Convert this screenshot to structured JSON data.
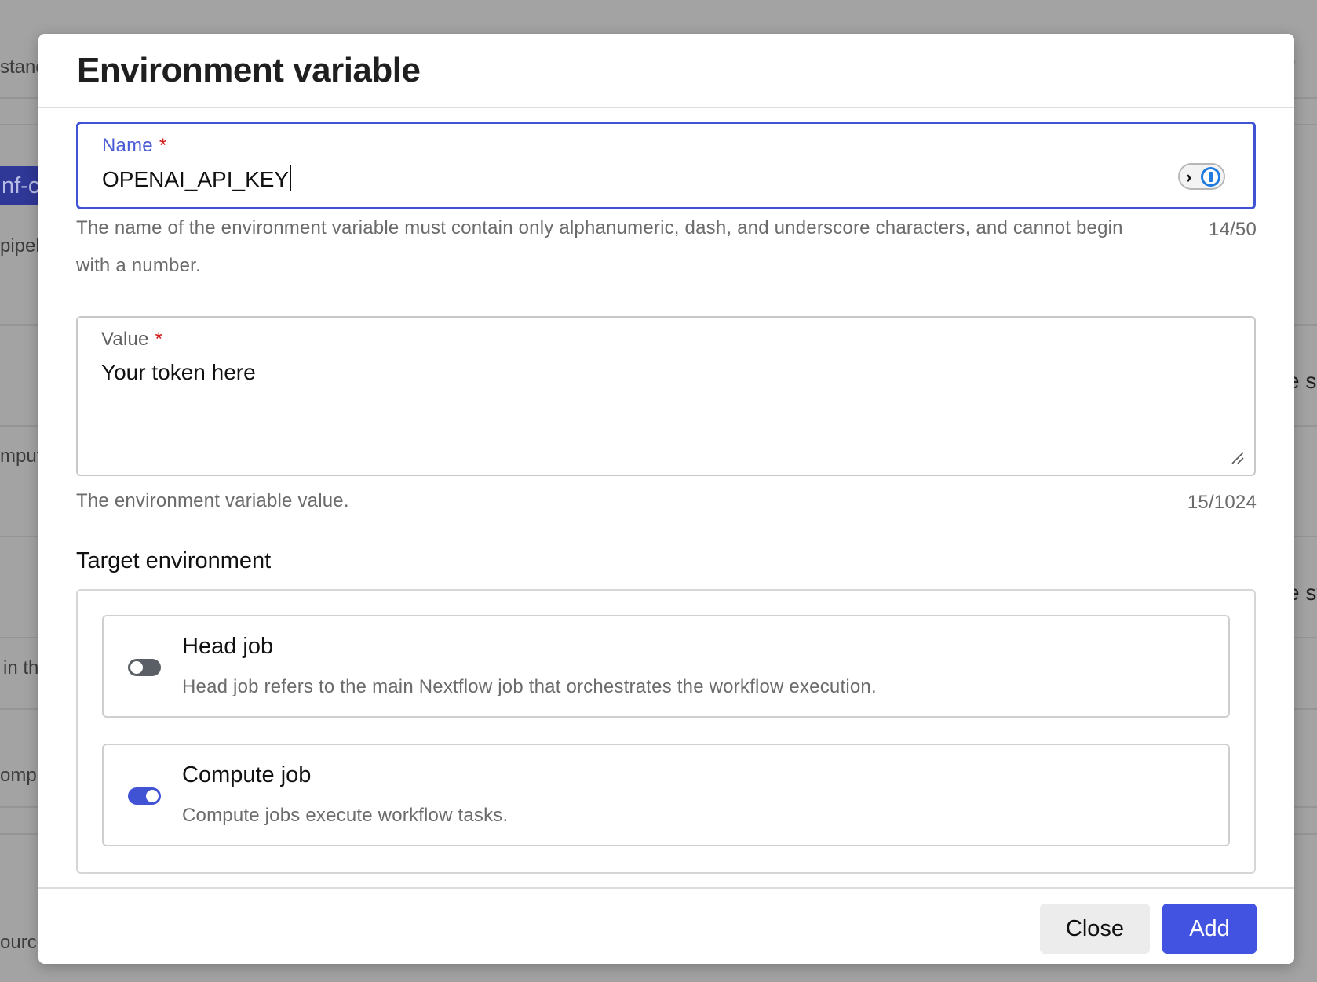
{
  "background": {
    "fragments": [
      "stand",
      "'",
      "nf-c",
      "pipel",
      "e s",
      "mput",
      "e sy",
      "in th",
      "ompu",
      "ource"
    ]
  },
  "modal": {
    "title": "Environment variable",
    "name_field": {
      "label": "Name",
      "required_mark": "*",
      "value": "OPENAI_API_KEY",
      "helper": "The name of the environment variable must contain only alphanumeric, dash, and underscore characters, and cannot begin with a number.",
      "counter": "14/50",
      "autofill_icon": "password-manager-icon"
    },
    "value_field": {
      "label": "Value",
      "required_mark": "*",
      "value": "Your token here",
      "helper": "The environment variable value.",
      "counter": "15/1024"
    },
    "target_environment": {
      "title": "Target environment",
      "options": [
        {
          "title": "Head job",
          "description": "Head job refers to the main Nextflow job that orchestrates the workflow execution.",
          "enabled": false
        },
        {
          "title": "Compute job",
          "description": "Compute jobs execute workflow tasks.",
          "enabled": true
        }
      ]
    },
    "footer": {
      "close_label": "Close",
      "add_label": "Add"
    }
  },
  "colors": {
    "accent": "#4153d5",
    "required": "#d11a1a",
    "toggle_off": "#5a5f66"
  }
}
